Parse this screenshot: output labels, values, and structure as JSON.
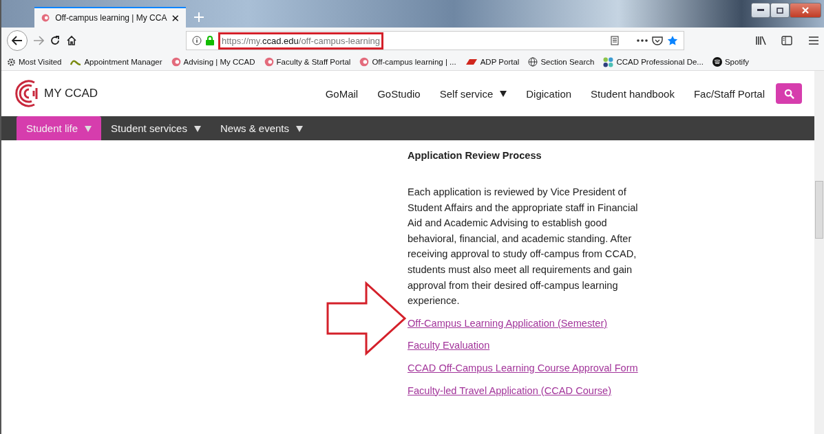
{
  "browser": {
    "tabs": [
      {
        "title": "Off-campus learning | My CCA",
        "selected": true
      }
    ],
    "url": {
      "prefix": "https://my.",
      "domain": "ccad.edu",
      "path": "/off-campus-learning",
      "highlighted": true
    },
    "bookmarks": [
      {
        "kind": "gear",
        "label": "Most Visited"
      },
      {
        "kind": "swoosh",
        "label": "Appointment Manager"
      },
      {
        "kind": "site",
        "label": "Advising | My CCAD"
      },
      {
        "kind": "site",
        "label": "Faculty & Staff Portal"
      },
      {
        "kind": "site",
        "label": "Off-campus learning | ..."
      },
      {
        "kind": "slant",
        "label": "ADP Portal"
      },
      {
        "kind": "globe",
        "label": "Section Search"
      },
      {
        "kind": "dots",
        "label": "CCAD Professional De..."
      },
      {
        "kind": "music",
        "label": "Spotify"
      }
    ]
  },
  "site": {
    "logo_text": "MY CCAD",
    "top_links": [
      {
        "label": "GoMail",
        "dropdown": false
      },
      {
        "label": "GoStudio",
        "dropdown": false
      },
      {
        "label": "Self service",
        "dropdown": true
      },
      {
        "label": "Digication",
        "dropdown": false
      },
      {
        "label": "Student handbook",
        "dropdown": false
      },
      {
        "label": "Fac/Staff Portal",
        "dropdown": false
      }
    ],
    "nav": [
      {
        "label": "Student life",
        "selected": true
      },
      {
        "label": "Student services",
        "selected": false
      },
      {
        "label": "News & events",
        "selected": false
      }
    ]
  },
  "content": {
    "heading": "Application Review Process",
    "paragraph": "Each application is reviewed by Vice President of Student Affairs and the appropriate staff in Financial Aid and Academic Advising to establish good behavioral, financial, and academic standing. After receiving approval to study off-campus from CCAD, students must also meet all requirements and gain approval from their desired off-campus learning experience.",
    "links": [
      {
        "label": "Off-Campus Learning Application (Semester)",
        "pointed": true
      },
      {
        "label": "Faculty Evaluation",
        "pointed": false
      },
      {
        "label": "CCAD Off-Campus Learning Course Approval Form",
        "pointed": false
      },
      {
        "label": "Faculty-led Travel Application (CCAD Course)",
        "pointed": false
      }
    ]
  }
}
